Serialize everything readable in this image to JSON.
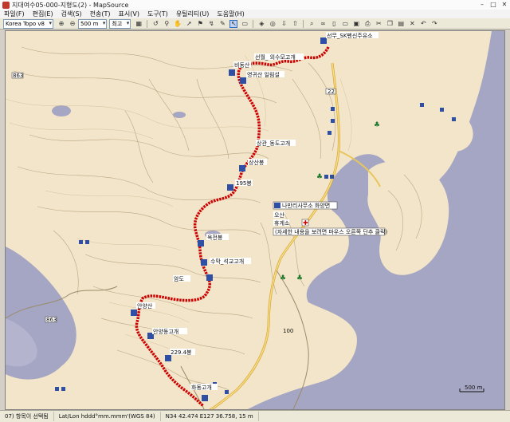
{
  "window": {
    "title": "지대여수05-000-지형도(2) - MapSource",
    "min": "–",
    "max": "□",
    "close": "✕"
  },
  "menu": [
    "파일(F)",
    "편집(E)",
    "검색(S)",
    "전송(T)",
    "표시(V)",
    "도구(T)",
    "유틸리티(U)",
    "도움말(H)"
  ],
  "toolbar": {
    "map_product": "Korea Topo v8",
    "scale": "500 m",
    "detail": "최고"
  },
  "map": {
    "labels": {
      "peak_top": "선무_SK펜신주유소",
      "biseonsa": "비동산",
      "sunwol": "선월_ 외수모고개",
      "yeonggwi": "영귀산 일림설",
      "dongjeong": "상관_동도고개",
      "balsan": "상산봉",
      "p195": "195봉",
      "manager": "나만리사무소 화양면",
      "office": "오산",
      "rest": "휴게소",
      "hint": "(자세한 내용을 보려면 마우스 오른쪽 단추 클릭)",
      "okjeon": "옥전봉",
      "sumakjae": "수막_석교고개",
      "amdo": "암도",
      "anyangsan": "안양산",
      "tokjae": "안양동고개",
      "p229": "229.4봉",
      "hwajae": "화동고개",
      "road22": "22",
      "road863a": "863",
      "road863b": "863",
      "road100": "100",
      "scalebar": "500 m"
    }
  },
  "status": {
    "track_info": "07) 항목이 선택됨",
    "position_format": "Lat/Lon hddd°mm.mmm'(WGS 84)",
    "coords": "N34 42.474 E127 36.758, 15 m"
  },
  "colors": {
    "land": "#f3e5c9",
    "water": "#a5a5c4",
    "track": "#cc0000",
    "road": "#e8c65a",
    "contour": "#b9a583"
  }
}
